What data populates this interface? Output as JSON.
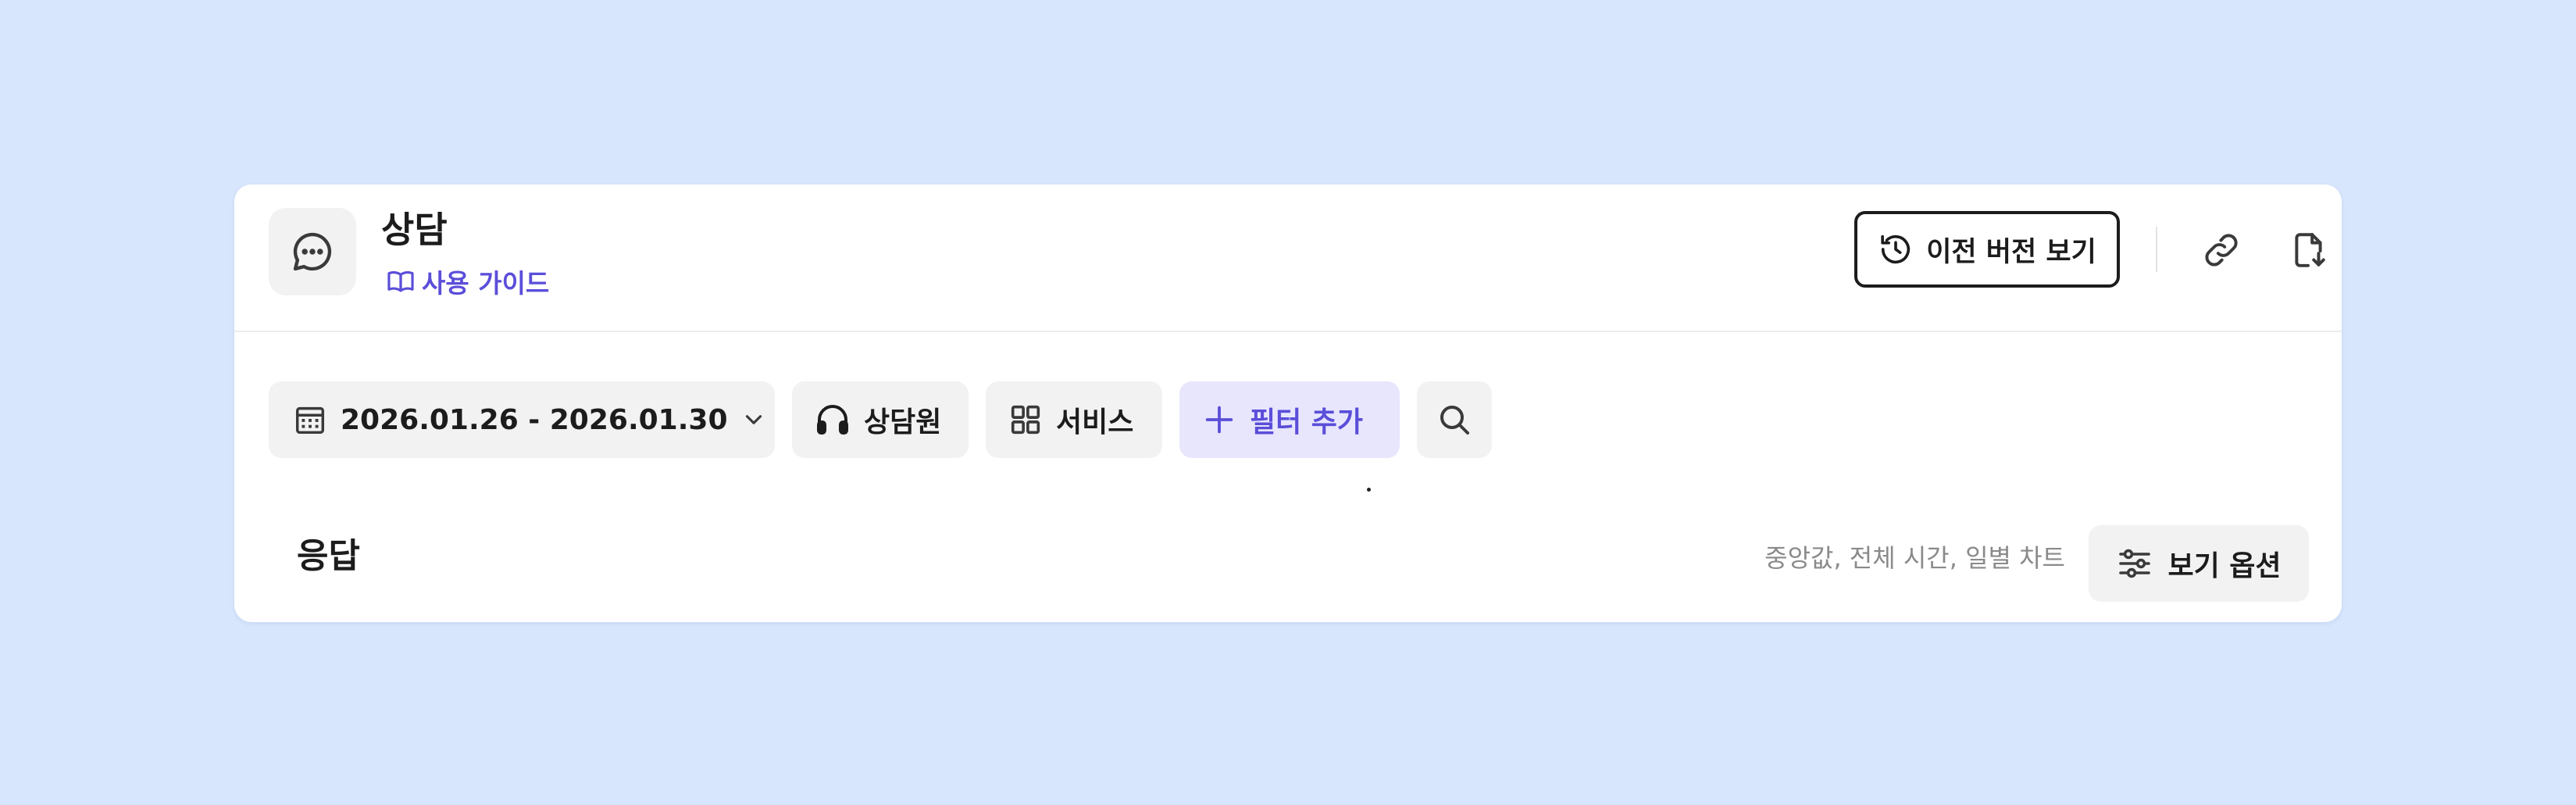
{
  "header": {
    "title": "상담",
    "guide_label": "사용 가이드",
    "history_label": "이전 버전 보기",
    "icons": {
      "app": "chat-bubble-icon",
      "guide": "book-icon",
      "history": "history-icon",
      "link": "link-icon",
      "export": "file-export-icon"
    }
  },
  "filters": {
    "date_range": "2026.01.26 - 2026.01.30",
    "agent_label": "상담원",
    "service_label": "서비스",
    "add_filter_label": "필터 추가"
  },
  "section": {
    "title": "응답",
    "view_summary": "중앙값, 전체 시간, 일별 차트",
    "view_options_label": "보기 옵션"
  },
  "colors": {
    "background": "#d7e5fd",
    "accent": "#5b4ed9",
    "accent_bg": "#e7e6fd",
    "chip_bg": "#f2f2f2"
  }
}
